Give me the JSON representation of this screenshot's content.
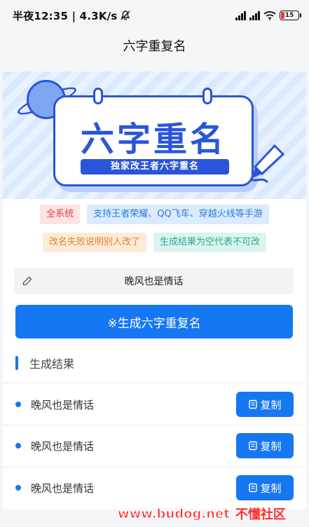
{
  "status_bar": {
    "time_text": "半夜12:35 | 4.3K/s",
    "battery": "15",
    "icons": [
      "mute-icon",
      "signal-hd-icon",
      "signal-hd-icon",
      "wifi-icon",
      "battery-icon"
    ]
  },
  "header": {
    "title": "六字重复名"
  },
  "banner": {
    "title": "六字重名",
    "subtitle": "独家改王者六字重名"
  },
  "tags": {
    "row1": [
      "全系统",
      "支持王者荣耀、QQ飞车、穿越火线等手游"
    ],
    "row2": [
      "改名失败说明别人改了",
      "生成结果为空代表不可改"
    ]
  },
  "input": {
    "value": "晚风也是情话"
  },
  "generate_button": {
    "label": "※生成六字重复名"
  },
  "results": {
    "title": "生成结果",
    "items": [
      {
        "text": "晚风也是情话",
        "copy_label": "复制"
      },
      {
        "text": "晚风也是情话",
        "copy_label": "复制"
      },
      {
        "text": "晚风也是情话",
        "copy_label": "复制"
      }
    ]
  },
  "watermark": {
    "url": "www.budog.net",
    "name": "不懂社区"
  },
  "colors": {
    "accent": "#1677f2",
    "banner_blue": "#2a55d8"
  }
}
